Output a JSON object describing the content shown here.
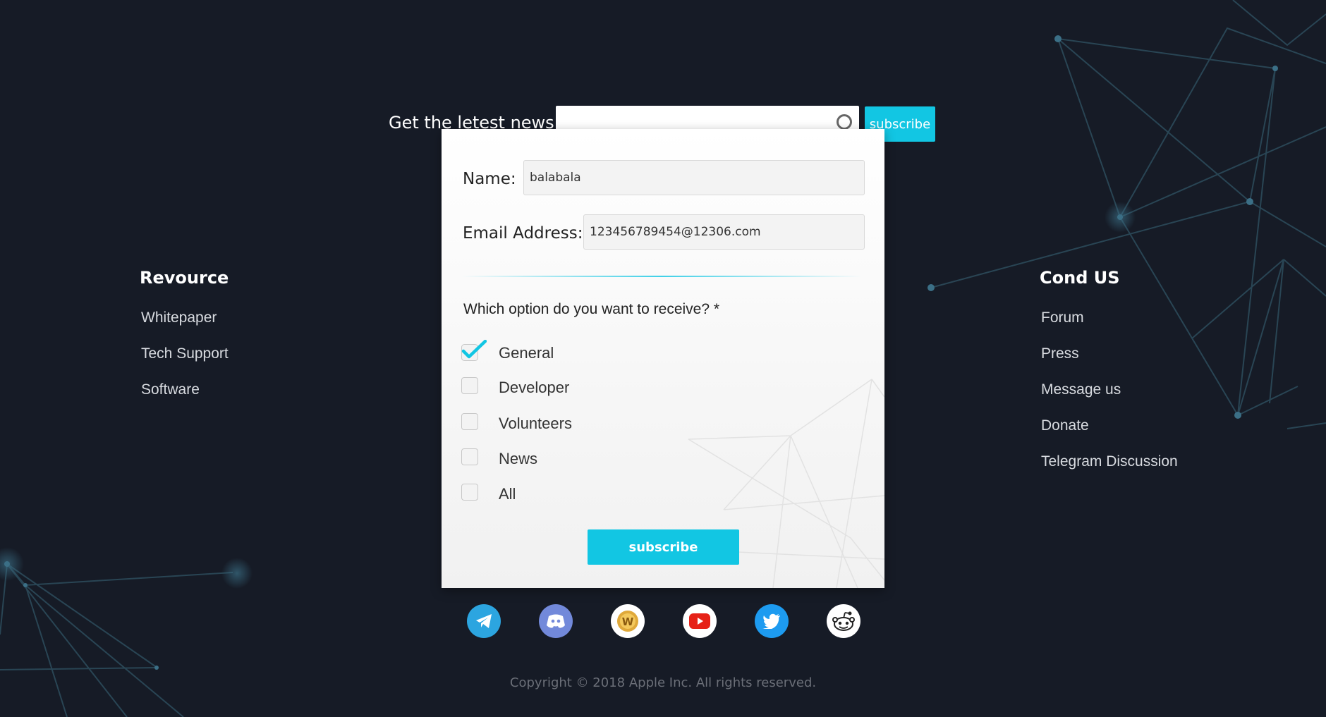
{
  "header": {
    "news_label": "Get the letest news",
    "search_value": "",
    "subscribe_label": "subscribe"
  },
  "left_column": {
    "title": "Revource",
    "links": [
      "Whitepaper",
      "Tech Support",
      "Software"
    ]
  },
  "right_column": {
    "title": "Cond  US",
    "links": [
      "Forum",
      "Press",
      "Message us",
      "Donate",
      "Telegram Discussion"
    ]
  },
  "modal": {
    "name_label": "Name:",
    "name_value": "balabala",
    "email_label": "Email Address:",
    "email_value": "123456789454@12306.com",
    "question": "Which option do you want to receive? *",
    "options": [
      {
        "label": "General",
        "checked": true
      },
      {
        "label": "Developer",
        "checked": false
      },
      {
        "label": "Volunteers",
        "checked": false
      },
      {
        "label": "News",
        "checked": false
      },
      {
        "label": "All",
        "checked": false
      }
    ],
    "subscribe_label": "subscribe"
  },
  "socials": [
    {
      "icon": "telegram-icon",
      "color": "#2ca5e0"
    },
    {
      "icon": "discord-icon",
      "color": "#7289da"
    },
    {
      "icon": "coin-icon",
      "color": "#ffffff"
    },
    {
      "icon": "youtube-icon",
      "color": "#ffffff"
    },
    {
      "icon": "twitter-icon",
      "color": "#1d9bf0"
    },
    {
      "icon": "reddit-icon",
      "color": "#ffffff"
    }
  ],
  "footer": {
    "copyright": "Copyright © 2018 Apple Inc. All rights reserved."
  },
  "colors": {
    "background": "#161b26",
    "accent": "#12c6e3"
  }
}
